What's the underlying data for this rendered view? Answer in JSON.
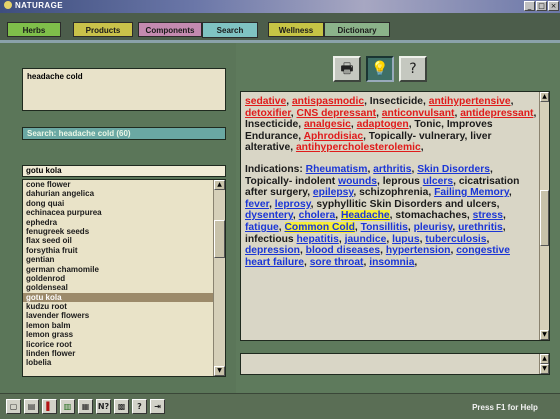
{
  "window": {
    "title": "NATURAGE"
  },
  "tabs": [
    {
      "label": "Herbs",
      "color": "#7fbf4a",
      "active": false
    },
    {
      "label": "Products",
      "color": "#c9c24a",
      "active": false
    },
    {
      "label": "Components",
      "color": "#c48ab0",
      "active": false
    },
    {
      "label": "Search",
      "color": "#7fc3c2",
      "active": true
    },
    {
      "label": "Wellness",
      "color": "#c6c445",
      "active": false
    },
    {
      "label": "Dictionary",
      "color": "#8bb38a",
      "active": false
    }
  ],
  "search": {
    "query": "headache cold",
    "status": "Search: headache cold (60)"
  },
  "herb_list": {
    "input_value": "gotu kola",
    "items": [
      "cone flower",
      "dahurian angelica",
      "dong quai",
      "echinacea purpurea",
      "ephedra",
      "fenugreek seeds",
      "flax seed oil",
      "forsythia fruit",
      "gentian",
      "german chamomile",
      "goldenrod",
      "goldenseal",
      "gotu kola",
      "kudzu root",
      "lavender flowers",
      "lemon balm",
      "lemon grass",
      "licorice root",
      "linden flower",
      "lobelia"
    ],
    "selected": "gotu kola"
  },
  "view_icons": [
    {
      "name": "printer-icon",
      "glyph": "🖶",
      "active": false
    },
    {
      "name": "lightbulb-icon",
      "glyph": "💡",
      "active": true
    },
    {
      "name": "help-icon",
      "glyph": "?",
      "active": false
    }
  ],
  "info": {
    "properties": [
      {
        "t": "sedative",
        "c": "red"
      },
      {
        "t": ", ",
        "c": ""
      },
      {
        "t": "antispasmodic",
        "c": "red"
      },
      {
        "t": ", Insecticide, ",
        "c": ""
      },
      {
        "t": "antihypertensive",
        "c": "red"
      },
      {
        "t": ", ",
        "c": ""
      },
      {
        "t": "detoxifier",
        "c": "red"
      },
      {
        "t": ", ",
        "c": ""
      },
      {
        "t": "CNS depressant",
        "c": "red"
      },
      {
        "t": ", ",
        "c": ""
      },
      {
        "t": "anticonvulsant",
        "c": "red"
      },
      {
        "t": ", ",
        "c": ""
      },
      {
        "t": "antidepressant",
        "c": "red"
      },
      {
        "t": ", Insecticide, ",
        "c": ""
      },
      {
        "t": "analgesic",
        "c": "red"
      },
      {
        "t": ", ",
        "c": ""
      },
      {
        "t": "adaptogen",
        "c": "red"
      },
      {
        "t": ", Tonic, Improves Endurance, ",
        "c": ""
      },
      {
        "t": "Aphrodisiac",
        "c": "red"
      },
      {
        "t": ", Topically- vulnerary, liver alterative, ",
        "c": ""
      },
      {
        "t": "antihypercholesterolemic",
        "c": "red"
      },
      {
        "t": ",",
        "c": ""
      }
    ],
    "indications_label": "Indications: ",
    "indications": [
      {
        "t": "Rheumatism",
        "c": "blue"
      },
      {
        "t": ", ",
        "c": ""
      },
      {
        "t": "arthritis",
        "c": "blue"
      },
      {
        "t": ", ",
        "c": ""
      },
      {
        "t": "Skin Disorders",
        "c": "blue"
      },
      {
        "t": ", Topically- indolent ",
        "c": ""
      },
      {
        "t": "wounds",
        "c": "blue"
      },
      {
        "t": ", leprous ",
        "c": ""
      },
      {
        "t": "ulcers",
        "c": "blue"
      },
      {
        "t": ", cicatrisation after surgery, ",
        "c": ""
      },
      {
        "t": "epilepsy",
        "c": "blue"
      },
      {
        "t": ", schizophrenia, ",
        "c": ""
      },
      {
        "t": "Failing Memory",
        "c": "blue"
      },
      {
        "t": ", ",
        "c": ""
      },
      {
        "t": "fever",
        "c": "blue"
      },
      {
        "t": ", ",
        "c": ""
      },
      {
        "t": "leprosy",
        "c": "blue"
      },
      {
        "t": ", syphyllitic Skin Disorders and ulcers, ",
        "c": ""
      },
      {
        "t": "dysentery",
        "c": "blue"
      },
      {
        "t": ", ",
        "c": ""
      },
      {
        "t": "cholera",
        "c": "blue"
      },
      {
        "t": ", ",
        "c": ""
      },
      {
        "t": "Headache",
        "c": "hl"
      },
      {
        "t": ", stomachaches, ",
        "c": ""
      },
      {
        "t": "stress",
        "c": "blue"
      },
      {
        "t": ", ",
        "c": ""
      },
      {
        "t": "fatigue",
        "c": "blue"
      },
      {
        "t": ", ",
        "c": ""
      },
      {
        "t": "Common Cold",
        "c": "hl"
      },
      {
        "t": ", ",
        "c": ""
      },
      {
        "t": "Tonsillitis",
        "c": "blue"
      },
      {
        "t": ", ",
        "c": ""
      },
      {
        "t": "pleurisy",
        "c": "blue"
      },
      {
        "t": ", ",
        "c": ""
      },
      {
        "t": "urethritis",
        "c": "blue"
      },
      {
        "t": ", infectious ",
        "c": ""
      },
      {
        "t": "hepatitis",
        "c": "blue"
      },
      {
        "t": ", ",
        "c": ""
      },
      {
        "t": "jaundice",
        "c": "blue"
      },
      {
        "t": ", ",
        "c": ""
      },
      {
        "t": "lupus",
        "c": "blue"
      },
      {
        "t": ", ",
        "c": ""
      },
      {
        "t": "tuberculosis",
        "c": "blue"
      },
      {
        "t": ", ",
        "c": ""
      },
      {
        "t": "depression",
        "c": "blue"
      },
      {
        "t": ", ",
        "c": ""
      },
      {
        "t": "blood diseases",
        "c": "blue"
      },
      {
        "t": ", ",
        "c": ""
      },
      {
        "t": "hypertension",
        "c": "blue"
      },
      {
        "t": ", ",
        "c": ""
      },
      {
        "t": "congestive heart failure",
        "c": "blue"
      },
      {
        "t": ", ",
        "c": ""
      },
      {
        "t": "sore throat",
        "c": "blue"
      },
      {
        "t": ", ",
        "c": ""
      },
      {
        "t": "insomnia",
        "c": "blue"
      },
      {
        "t": ",",
        "c": ""
      }
    ]
  },
  "toolbar": [
    {
      "name": "new-document-icon",
      "glyph": "▢",
      "style": ""
    },
    {
      "name": "print-icon",
      "glyph": "▤",
      "style": ""
    },
    {
      "name": "thermometer-icon",
      "glyph": "▌",
      "style": "red"
    },
    {
      "name": "book-icon",
      "glyph": "▥",
      "style": "green"
    },
    {
      "name": "grid-icon",
      "glyph": "▦",
      "style": ""
    },
    {
      "name": "notes-icon",
      "glyph": "N?",
      "style": ""
    },
    {
      "name": "calendar-icon",
      "glyph": "▩",
      "style": ""
    },
    {
      "name": "help-icon",
      "glyph": "?",
      "style": ""
    },
    {
      "name": "exit-icon",
      "glyph": "⇥",
      "style": ""
    }
  ],
  "statusbar": {
    "text": "Press F1 for Help"
  }
}
